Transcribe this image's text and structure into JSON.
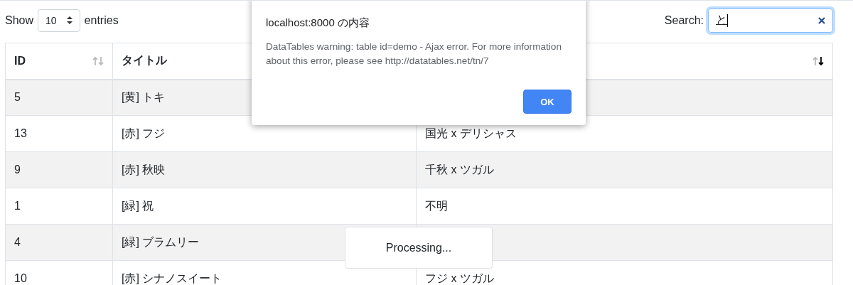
{
  "length_control": {
    "label_before": "Show",
    "value": "10",
    "label_after": "entries"
  },
  "search": {
    "label": "Search:",
    "value": "と",
    "composing": true
  },
  "table": {
    "columns": [
      {
        "label": "ID",
        "sortable": true,
        "sorted_desc": false
      },
      {
        "label": "タイトル"
      },
      {
        "sortable": true,
        "sorted_desc": true
      }
    ],
    "rows": [
      {
        "id": "5",
        "title": "[黄] トキ"
      },
      {
        "id": "13",
        "title": "[赤] フジ",
        "column_3": "国光 x デリシャス"
      },
      {
        "id": "9",
        "title": "[赤] 秋映",
        "column_3": "千秋 x ツガル"
      },
      {
        "id": "1",
        "title": "[緑] 祝",
        "column_3": "不明"
      },
      {
        "id": "4",
        "title": "[緑] ブラムリー"
      },
      {
        "id": "10",
        "title": "[赤] シナノスイート",
        "column_3": "フジ x ツガル"
      }
    ]
  },
  "dialog": {
    "title": "localhost:8000 の内容",
    "message": "DataTables warning: table id=demo - Ajax error. For more information about this error, please see http://datatables.net/tn/7",
    "button": "OK"
  },
  "processing": {
    "text": "Processing..."
  }
}
